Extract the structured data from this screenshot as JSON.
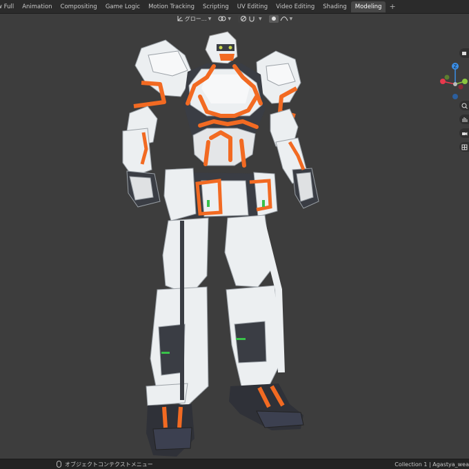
{
  "tabs": [
    {
      "label": "w Full",
      "active": false
    },
    {
      "label": "Animation",
      "active": false
    },
    {
      "label": "Compositing",
      "active": false
    },
    {
      "label": "Game Logic",
      "active": false
    },
    {
      "label": "Motion Tracking",
      "active": false
    },
    {
      "label": "Scripting",
      "active": false
    },
    {
      "label": "UV Editing",
      "active": false
    },
    {
      "label": "Video Editing",
      "active": false
    },
    {
      "label": "Shading",
      "active": false
    },
    {
      "label": "Modeling",
      "active": true
    }
  ],
  "add_tab_symbol": "+",
  "header": {
    "transform_orientation": "グロー…",
    "pivot_icon": "pivot-icon",
    "snap_icon": "snap-icon",
    "proportional_icon": "proportional-edit-icon",
    "falloff_icon": "falloff-curve-icon"
  },
  "gizmo": {
    "axis_colors": {
      "x": "#e8394d",
      "y": "#8bc53f",
      "z": "#3b8fe8"
    },
    "z_label": "Z"
  },
  "statusbar": {
    "left_text": "オブジェクトコンテクストメニュー",
    "right_text": "Collection 1 | Agastya_wea"
  },
  "colors": {
    "background": "#3d3d3d",
    "armor_white": "#ecedef",
    "armor_orange": "#f26a22",
    "armor_dark": "#3a3d44",
    "accent_green": "#39c24a"
  }
}
